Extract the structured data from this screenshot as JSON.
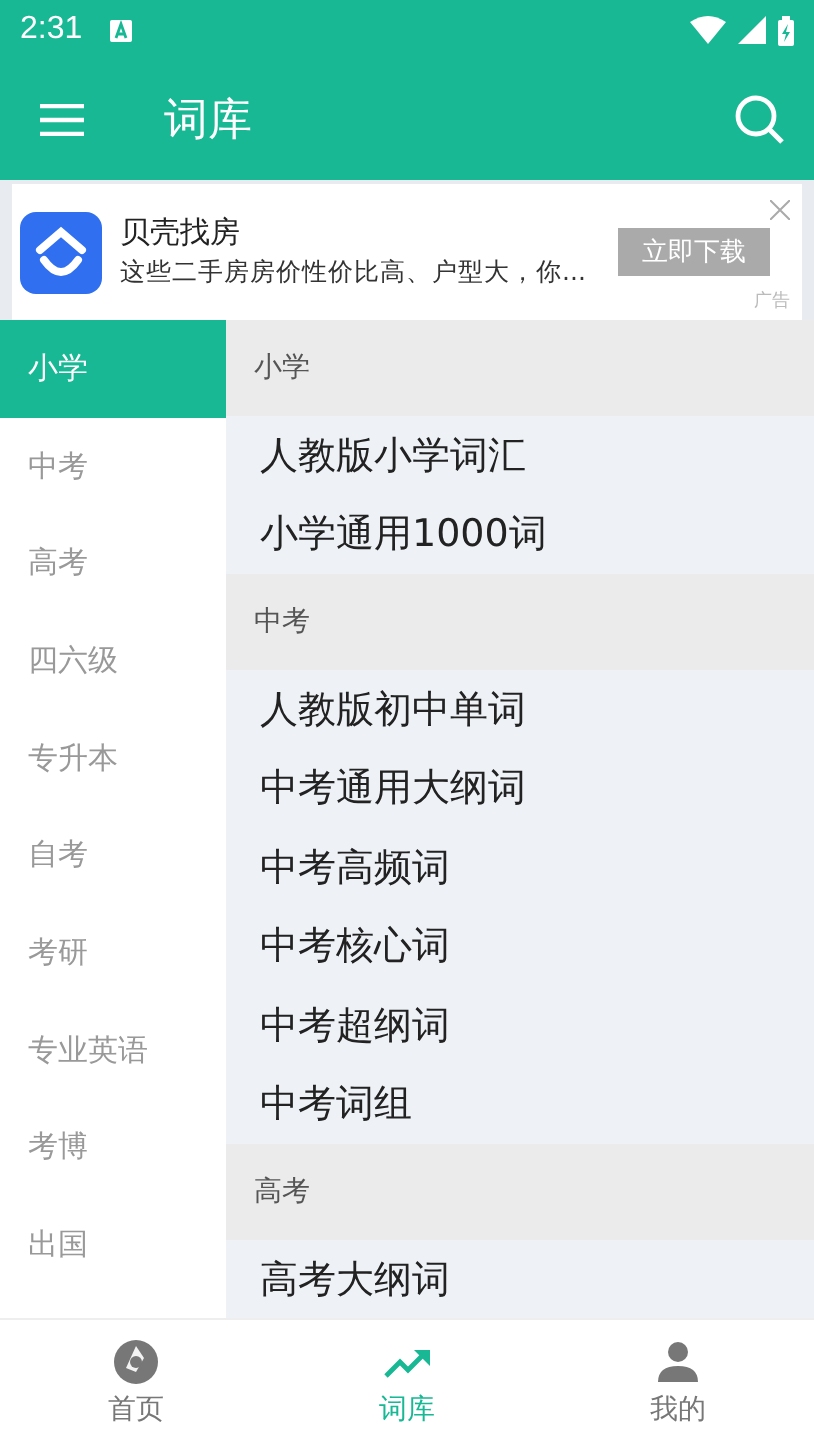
{
  "status_bar": {
    "time": "2:31"
  },
  "app_bar": {
    "title": "词库"
  },
  "ad": {
    "title": "贝壳找房",
    "text": "这些二手房房价性价比高、户型大，你...",
    "button": "立即下载",
    "tag": "广告"
  },
  "sidebar": {
    "items": [
      {
        "label": "小学",
        "selected": true
      },
      {
        "label": "中考",
        "selected": false
      },
      {
        "label": "高考",
        "selected": false
      },
      {
        "label": "四六级",
        "selected": false
      },
      {
        "label": "专升本",
        "selected": false
      },
      {
        "label": "自考",
        "selected": false
      },
      {
        "label": "考研",
        "selected": false
      },
      {
        "label": "专业英语",
        "selected": false
      },
      {
        "label": "考博",
        "selected": false
      },
      {
        "label": "出国",
        "selected": false
      }
    ]
  },
  "sections": [
    {
      "title": "小学",
      "items": [
        "人教版小学词汇",
        "小学通用1000词"
      ]
    },
    {
      "title": "中考",
      "items": [
        "人教版初中单词",
        "中考通用大纲词",
        "中考高频词",
        "中考核心词",
        "中考超纲词",
        "中考词组"
      ]
    },
    {
      "title": "高考",
      "items": [
        "高考大纲词"
      ]
    }
  ],
  "bottom_nav": [
    {
      "label": "首页",
      "selected": false
    },
    {
      "label": "词库",
      "selected": true
    },
    {
      "label": "我的",
      "selected": false
    }
  ]
}
